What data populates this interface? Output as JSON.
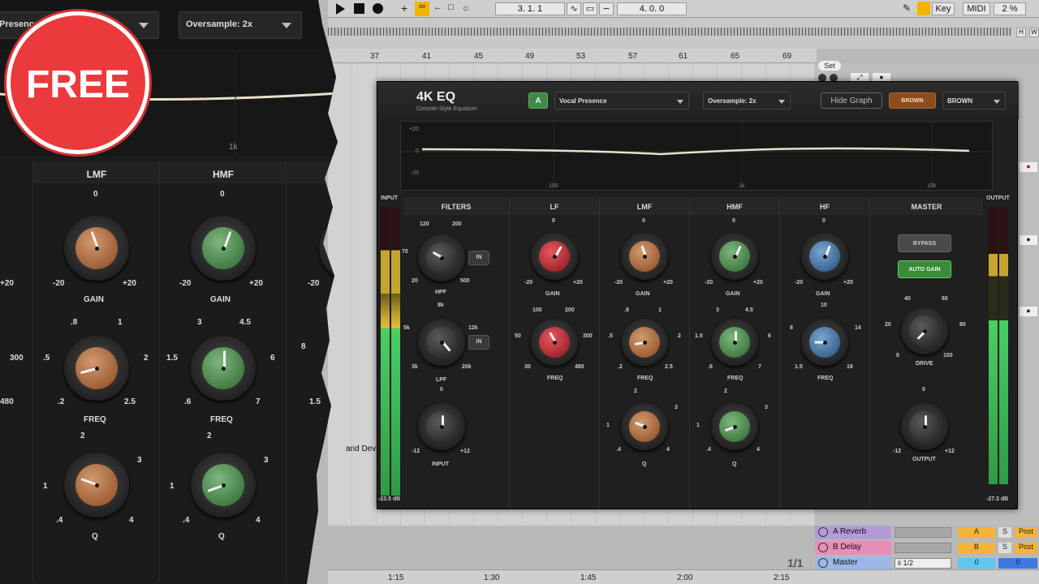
{
  "colors": {
    "orange": "#c98052",
    "green": "#5f9b5f",
    "red": "#cc3b42",
    "blue": "#5f8fbd",
    "free_badge": "#ea3a3c",
    "auto_gain": "#3a8a3a",
    "brown": "#8b4c1e"
  },
  "left_panel": {
    "preset_text": "Presence",
    "oversample": "Oversample: 2x",
    "graph_tick": "1k",
    "lmf": {
      "title": "LMF",
      "gain_top": "0",
      "gain_min": "-20",
      "gain_max": "+20",
      "gain_label": "GAIN",
      "freq_values": [
        ".8",
        "1",
        ".5",
        "2",
        ".2",
        "2.5"
      ],
      "freq_label": "FREQ",
      "q_values": [
        "2",
        "3",
        "1",
        ".4",
        "4"
      ],
      "q_label": "Q"
    },
    "hmf": {
      "title": "HMF",
      "gain_top": "0",
      "gain_min": "-20",
      "gain_max": "+20",
      "gain_label": "GAIN",
      "freq_values": [
        "3",
        "4.5",
        "1.5",
        "6",
        ".6",
        "7"
      ],
      "freq_label": "FREQ",
      "q_values": [
        "2",
        "3",
        "1",
        ".4",
        "4"
      ],
      "q_label": "Q"
    },
    "edge_labels": {
      "lf_max": "+20",
      "lf_300": "300",
      "lf_480": "480",
      "hf_min": "-20",
      "hf_8": "8",
      "hf_15": "1.5"
    }
  },
  "badge": {
    "text": "FREE"
  },
  "daw": {
    "position": "3.  1.  1",
    "loop_length": "4.  0.  0",
    "key": "Key",
    "midi": "MIDI",
    "cpu": "2 %",
    "h": "H",
    "w": "W",
    "set": "Set",
    "ruler": [
      "37",
      "41",
      "45",
      "49",
      "53",
      "57",
      "61",
      "65",
      "69"
    ],
    "times": [
      "1:15",
      "1:30",
      "1:45",
      "2:00",
      "2:15"
    ],
    "clip_text": "and Dev",
    "page": "1/1",
    "returns": [
      {
        "name": "A Reverb",
        "letter": "A",
        "s": "S",
        "post": "Post"
      },
      {
        "name": "B Delay",
        "letter": "B",
        "s": "S",
        "post": "Post"
      },
      {
        "name": "Master",
        "input": "ii 1/2",
        "v1": "0",
        "v2": "0"
      }
    ]
  },
  "plugin": {
    "name": "4K EQ",
    "subtitle": "Console-Style Equalizer",
    "ab": "A",
    "preset": "Vocal Presence",
    "oversample": "Oversample: 2x",
    "hide_graph": "Hide Graph",
    "brown": "BROWN",
    "brown_select": "BROWN",
    "graph": {
      "y": [
        "+20",
        "0",
        "-20"
      ],
      "x": [
        "100",
        "1k",
        "10k"
      ]
    },
    "input_label": "INPUT",
    "output_label": "OUTPUT",
    "input_db": "-23.5 dB",
    "output_db": "-27.3 dB",
    "filters": {
      "title": "FILTERS",
      "hpf": [
        "120",
        "200",
        "70",
        "20",
        "500"
      ],
      "hpf_label": "HPF",
      "in": "IN",
      "lpf": [
        "8k",
        "5k",
        "12k",
        "3k",
        "20k"
      ],
      "lpf_label": "LPF",
      "input": [
        "0",
        "-12",
        "+12"
      ],
      "input_label": "INPUT"
    },
    "lf": {
      "title": "LF",
      "gain": [
        "0",
        "-20",
        "+20"
      ],
      "gain_label": "GAIN",
      "freq": [
        "100",
        "200",
        "50",
        "300",
        "30",
        "480"
      ],
      "freq_label": "FREQ"
    },
    "lmf": {
      "title": "LMF",
      "gain": [
        "0",
        "-20",
        "+20"
      ],
      "gain_label": "GAIN",
      "freq": [
        ".8",
        "1",
        ".5",
        "2",
        ".2",
        "2.5"
      ],
      "freq_label": "FREQ",
      "q": [
        "2",
        "3",
        "1",
        ".4",
        "4"
      ],
      "q_label": "Q"
    },
    "hmf": {
      "title": "HMF",
      "gain": [
        "0",
        "-20",
        "+20"
      ],
      "gain_label": "GAIN",
      "freq": [
        "3",
        "4.5",
        "1.5",
        "6",
        ".6",
        "7"
      ],
      "freq_label": "FREQ",
      "q": [
        "2",
        "3",
        "1",
        ".4",
        "4"
      ],
      "q_label": "Q"
    },
    "hf": {
      "title": "HF",
      "gain": [
        "0",
        "-20",
        "+20"
      ],
      "gain_label": "GAIN",
      "freq": [
        "10",
        "8",
        "14",
        "1.5",
        "16"
      ],
      "freq_label": "FREQ"
    },
    "master": {
      "title": "MASTER",
      "bypass": "BYPASS",
      "auto_gain": "AUTO GAIN",
      "drive": [
        "40",
        "60",
        "20",
        "80",
        "0",
        "100"
      ],
      "drive_label": "DRIVE",
      "output": [
        "0",
        "-12",
        "+12"
      ],
      "output_label": "OUTPUT"
    },
    "meter_lr": [
      "L",
      "R"
    ]
  }
}
